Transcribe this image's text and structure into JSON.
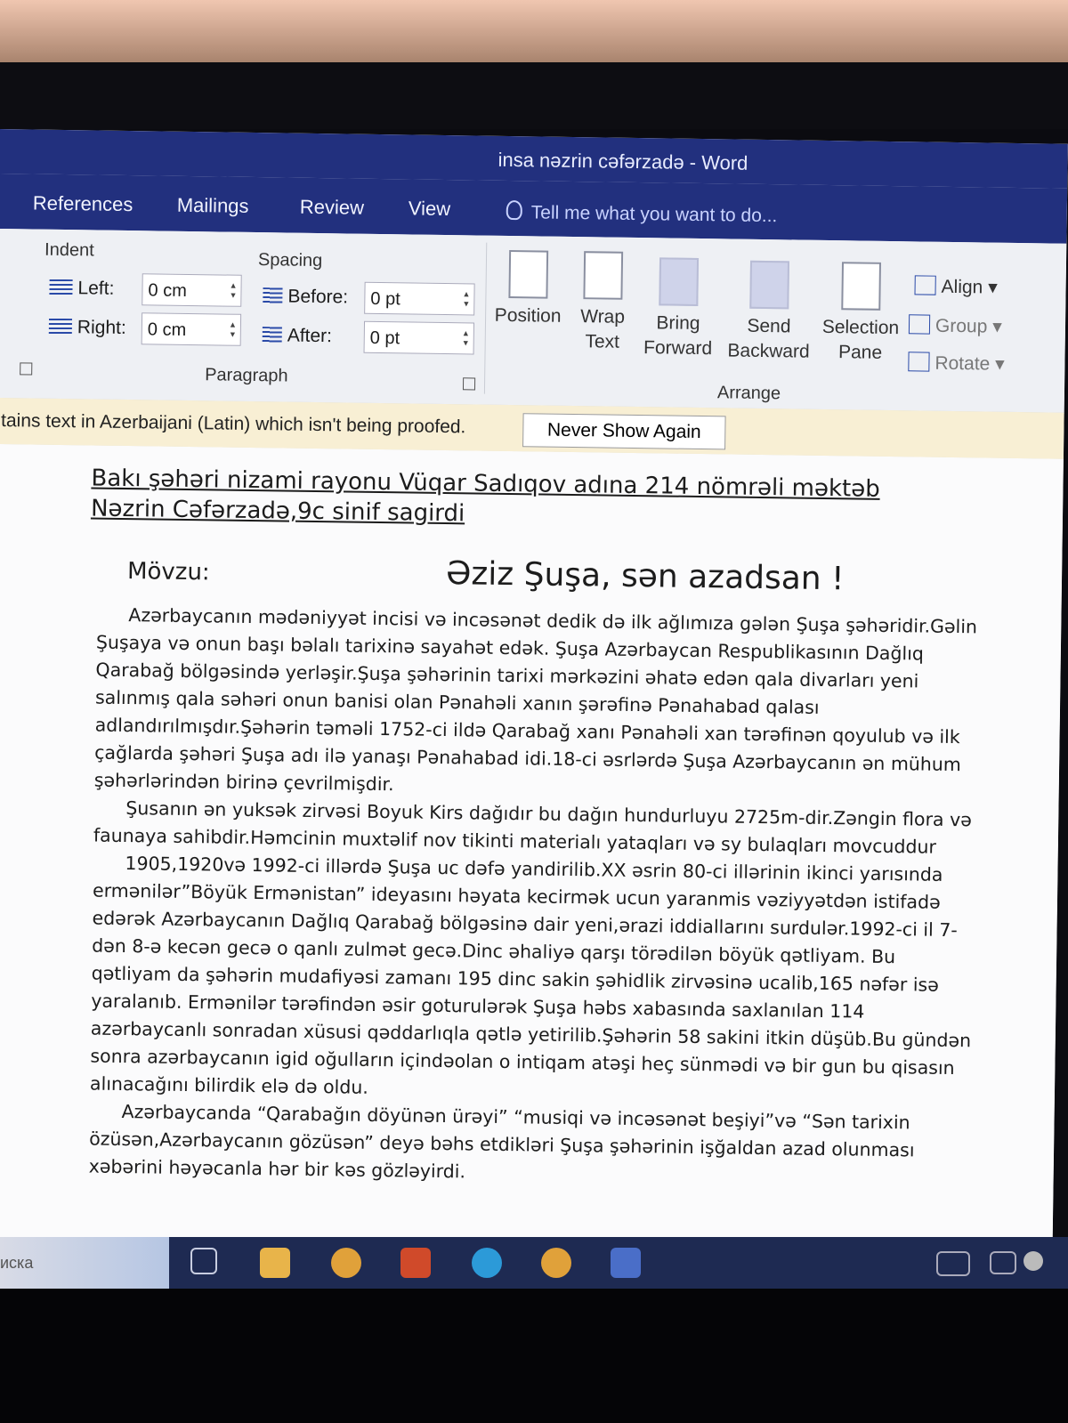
{
  "window": {
    "title": "insa nəzrin cəfərzadə - Word"
  },
  "tabs": [
    {
      "label": "References"
    },
    {
      "label": "Mailings"
    },
    {
      "label": "Review"
    },
    {
      "label": "View"
    }
  ],
  "tell_me": {
    "placeholder": "Tell me what you want to do..."
  },
  "paragraph_group": {
    "indent_label": "Indent",
    "spacing_label": "Spacing",
    "left_label": "Left:",
    "left_value": "0 cm",
    "right_label": "Right:",
    "right_value": "0 cm",
    "before_label": "Before:",
    "before_value": "0 pt",
    "after_label": "After:",
    "after_value": "0 pt",
    "group_label": "Paragraph"
  },
  "arrange_group": {
    "position": "Position",
    "wrap": [
      "Wrap",
      "Text"
    ],
    "bring": [
      "Bring",
      "Forward"
    ],
    "send": [
      "Send",
      "Backward"
    ],
    "selection": [
      "Selection",
      "Pane"
    ],
    "align": "Align",
    "group": "Group",
    "rotate": "Rotate",
    "group_label": "Arrange"
  },
  "message_bar": {
    "text": "ntains text in Azerbaijani (Latin) which isn't being proofed.",
    "button": "Never Show Again"
  },
  "document": {
    "header_line1": "Bakı şəhəri nizami rayonu Vüqar Sadıqov  adına 214 nömrəli məktəb",
    "header_line2": "Nəzrin Cəfərzadə,9c sinif sagirdi",
    "topic_label": "Mövzu:",
    "title": "Əziz Şuşa, sən azadsan !",
    "lines": [
      "Azərbaycanın mədəniyyət incisi və incəsənət dedik də ilk ağlımıza gələn Şuşa şəhəridir.Gəlin",
      "Şuşaya və onun başı bəlalı tarixinə sayahət edək. Şuşa Azərbaycan Respublikasının Dağlıq",
      "Qarabağ bölgəsində yerləşir.Şuşa şəhərinin tarixi mərkəzini əhatə edən qala divarları yeni",
      "salınmış qala səhəri onun banisi olan Pənahəli xanın şərəfinə Pənahabad qalası",
      "adlandırılmışdır.Şəhərin təməli 1752-ci ildə Qarabağ xanı Pənahəli xan tərəfinən qoyulub və ilk",
      "çağlarda şəhəri Şuşa adı ilə yanaşı Pənahabad idi.18-ci əsrlərdə Şuşa Azərbaycanın ən mühum",
      "şəhərlərindən birinə çevrilmişdir.",
      "Şusanın ən yuksək zirvəsi Boyuk Kirs dağıdır bu dağın hundurluyu 2725m-dir.Zəngin flora və",
      "faunaya sahibdir.Həmcinin muxtəlif nov tikinti materialı yataqları və sy bulaqları movcuddur",
      "1905,1920və 1992-ci illərdə Şuşa uc dəfə yandirilib.XX əsrin 80-ci illərinin ikinci yarısında",
      "ermənilər”Böyük Ermənistan” ideyasını həyata kecirmək ucun yaranmis vəziyyətdən istifadə",
      "edərək Azərbaycanın Dağlıq Qarabağ bölgəsinə dair yeni,ərazi iddiallarını surdulər.1992-ci il 7-",
      "dən 8-ə kecən gecə o qanlı zulmət gecə.Dinc əhaliyə qarşı törədilən böyük qətliyam. Bu",
      "qətliyam da şəhərin mudafiyəsi zamanı 195 dinc sakin şəhidlik zirvəsinə ucalib,165 nəfər isə",
      "yaralanıb. Ermənilər tərəfindən əsir goturulərək Şuşa həbs xabasında saxlanılan 114",
      "azərbaycanlı sonradan xüsusi qəddarlıqla qətlə yetirilib.Şəhərin 58 sakini itkin düşüb.Bu gündən",
      "sonra azərbaycanın igid oğulların içindəolan o intiqam atəşi heç sünmədi və bir gun bu qisasın",
      "alınacağını bilirdik elə də oldu.",
      "Azərbaycanda “Qarabağın döyünən ürəyi” “musiqi və incəsənət beşiyi”və “Sən tarixin",
      "özüsən,Azərbaycanın gözüsən” deyə bəhs etdikləri Şuşa şəhərinin işğaldan azad olunması",
      "xəbərini həyəcanla hər bir kəs gözləyirdi."
    ]
  },
  "taskbar": {
    "search_text": "иска"
  }
}
